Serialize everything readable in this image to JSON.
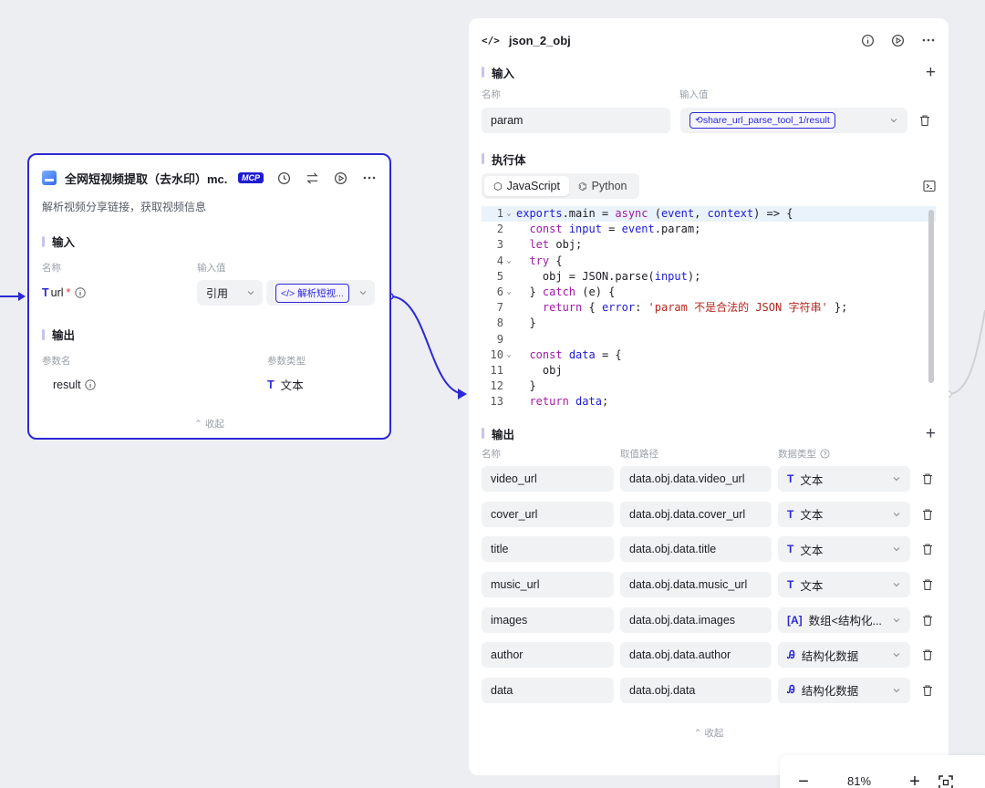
{
  "left_node": {
    "title": "全网短视频提取（去水印）mc...",
    "badge": "MCP",
    "description": "解析视频分享链接，获取视频信息",
    "input_section": "输入",
    "col_name": "名称",
    "col_value": "输入值",
    "param_type_glyph": "T",
    "param_name": "url",
    "required_mark": "*",
    "ref_mode": "引用",
    "ref_chip": "</> 解析短视...",
    "output_section": "输出",
    "out_col_name": "参数名",
    "out_col_type": "参数类型",
    "out_param": "result",
    "out_type_glyph": "T",
    "out_type": "文本",
    "collapse": "收起"
  },
  "right_node": {
    "title": "json_2_obj",
    "title_glyph": "</>",
    "input_section": "输入",
    "col_name": "名称",
    "col_value": "输入值",
    "input_param": "param",
    "input_chip": "share_url_parse_tool_1/result",
    "exec_section": "执行体",
    "tabs": [
      "JavaScript",
      "Python"
    ],
    "code": [
      {
        "n": "1",
        "fold": "⌄",
        "t": "exports.main = async (event, context) => {"
      },
      {
        "n": "2",
        "fold": "",
        "t": "  const input = event.param;"
      },
      {
        "n": "3",
        "fold": "",
        "t": "  let obj;"
      },
      {
        "n": "4",
        "fold": "⌄",
        "t": "  try {"
      },
      {
        "n": "5",
        "fold": "",
        "t": "    obj = JSON.parse(input);"
      },
      {
        "n": "6",
        "fold": "⌄",
        "t": "  } catch (e) {"
      },
      {
        "n": "7",
        "fold": "",
        "t": "    return { error: 'param 不是合法的 JSON 字符串' };"
      },
      {
        "n": "8",
        "fold": "",
        "t": "  }"
      },
      {
        "n": "9",
        "fold": "",
        "t": ""
      },
      {
        "n": "10",
        "fold": "⌄",
        "t": "  const data = {"
      },
      {
        "n": "11",
        "fold": "",
        "t": "    obj"
      },
      {
        "n": "12",
        "fold": "",
        "t": "  }"
      },
      {
        "n": "13",
        "fold": "",
        "t": "  return data;"
      }
    ],
    "output_section": "输出",
    "out_col_name": "名称",
    "out_col_path": "取值路径",
    "out_col_type": "数据类型",
    "outputs": [
      {
        "name": "video_url",
        "path": "data.obj.data.video_url",
        "glyph": "T",
        "type": "文本"
      },
      {
        "name": "cover_url",
        "path": "data.obj.data.cover_url",
        "glyph": "T",
        "type": "文本"
      },
      {
        "name": "title",
        "path": "data.obj.data.title",
        "glyph": "T",
        "type": "文本"
      },
      {
        "name": "music_url",
        "path": "data.obj.data.music_url",
        "glyph": "T",
        "type": "文本"
      },
      {
        "name": "images",
        "path": "data.obj.data.images",
        "glyph": "[A]",
        "type": "数组<结构化..."
      },
      {
        "name": "author",
        "path": "data.obj.data.author",
        "glyph": "Ꭿ",
        "type": "结构化数据"
      },
      {
        "name": "data",
        "path": "data.obj.data",
        "glyph": "Ꭿ",
        "type": "结构化数据"
      }
    ],
    "collapse": "收起"
  },
  "zoom": {
    "minus": "−",
    "level": "81%",
    "plus": "+"
  },
  "colors": {
    "accent": "#2c28d6",
    "canvas": "#eceef1"
  }
}
